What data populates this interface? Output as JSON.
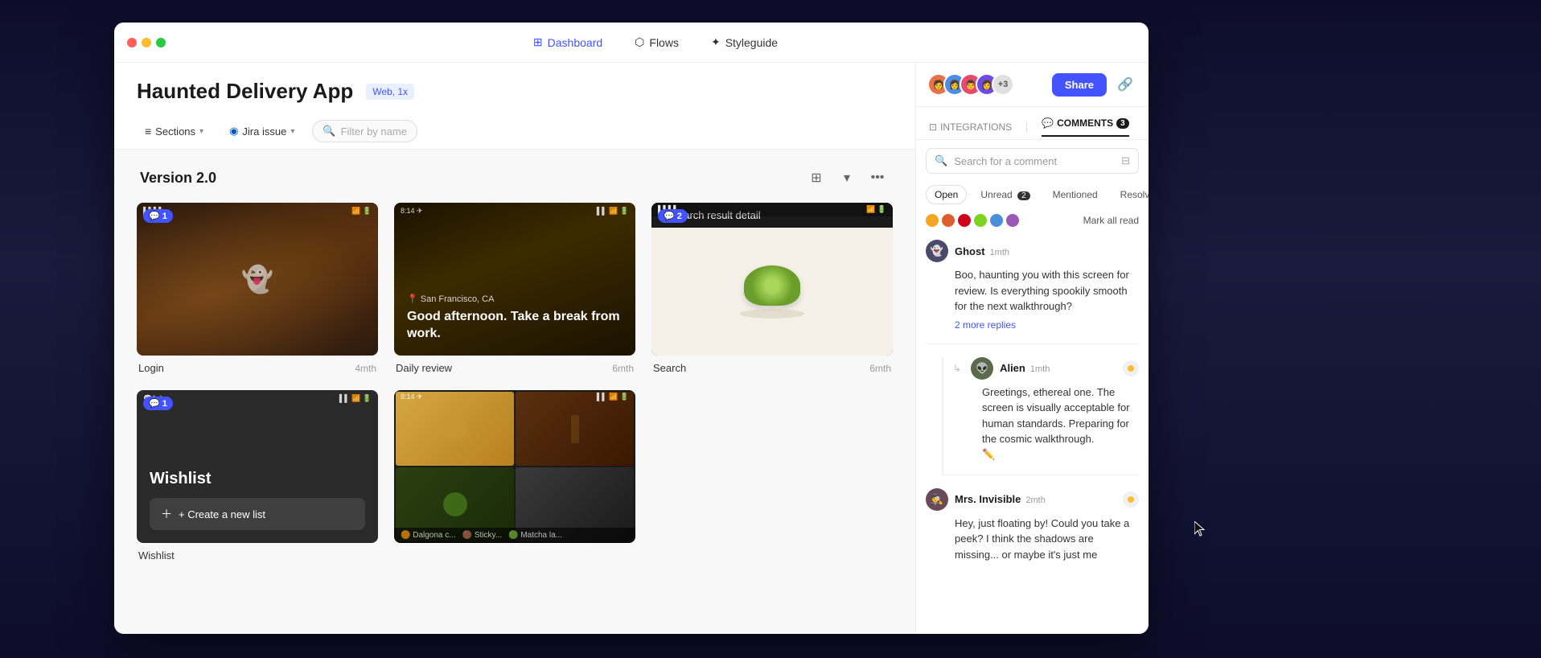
{
  "window": {
    "title": "Haunted Delivery App",
    "badge": "Web, 1x"
  },
  "titlebar": {
    "traffic_lights": [
      "red",
      "yellow",
      "green"
    ],
    "nav_items": [
      {
        "label": "Dashboard",
        "icon": "⊞",
        "active": true
      },
      {
        "label": "Flows",
        "icon": "◈"
      },
      {
        "label": "Styleguide",
        "icon": "✦"
      }
    ]
  },
  "toolbar": {
    "sections_label": "Sections",
    "jira_label": "Jira issue",
    "filter_placeholder": "Filter by name"
  },
  "canvas": {
    "section_title": "Version 2.0",
    "frames": [
      {
        "name": "Login",
        "time": "4mth",
        "comment_badge": "1",
        "has_status": false
      },
      {
        "name": "Daily review",
        "time": "6mth",
        "comment_badge": null,
        "has_status": false
      },
      {
        "name": "Search",
        "time": "6mth",
        "comment_badge": "2",
        "has_status": false
      }
    ],
    "frames2": [
      {
        "name": "Wishlist",
        "time": "",
        "comment_badge": "1",
        "has_status": false
      },
      {
        "name": "",
        "time": "",
        "comment_badge": null,
        "has_status": false
      }
    ],
    "add_list_label": "+ Create a new list"
  },
  "comments_panel": {
    "title": "COMMENTS",
    "badge": "3",
    "share_label": "Share",
    "integrations_label": "INTEGRATIONS",
    "search_placeholder": "Search for a comment",
    "tabs": [
      {
        "label": "Open",
        "active": true,
        "badge": null
      },
      {
        "label": "Unread",
        "active": false,
        "badge": "2"
      },
      {
        "label": "Mentioned",
        "active": false,
        "badge": null
      },
      {
        "label": "Resolv...",
        "active": false,
        "badge": null
      }
    ],
    "mark_all_read": "Mark all read",
    "color_dots": [
      "#f5a623",
      "#e05c2e",
      "#d0021b",
      "#7ed321",
      "#4a90d9",
      "#9b59b6"
    ],
    "comments": [
      {
        "author": "Ghost",
        "time": "1mth",
        "avatar_emoji": "👻",
        "avatar_bg": "#4a4a6a",
        "text": "Boo, haunting you with this screen for review. Is everything spookily smooth for the next walkthrough?",
        "replies_label": "2 more replies",
        "status_color": null
      },
      {
        "author": "Alien",
        "time": "1mth",
        "avatar_emoji": "👽",
        "avatar_bg": "#5a6a4a",
        "text": "Greetings, ethereal one. The screen is visually acceptable for human standards. Preparing for the cosmic walkthrough.",
        "replies_label": null,
        "status_color": "#ffbd2e",
        "is_reply": true
      },
      {
        "author": "Mrs. Invisible",
        "time": "2mth",
        "avatar_emoji": "🕵️",
        "avatar_bg": "#6a4a5a",
        "text": "Hey, just floating by! Could you take a peek? I think the shadows are missing... or maybe it's just me",
        "replies_label": null,
        "status_color": "#ffbd2e"
      }
    ]
  }
}
